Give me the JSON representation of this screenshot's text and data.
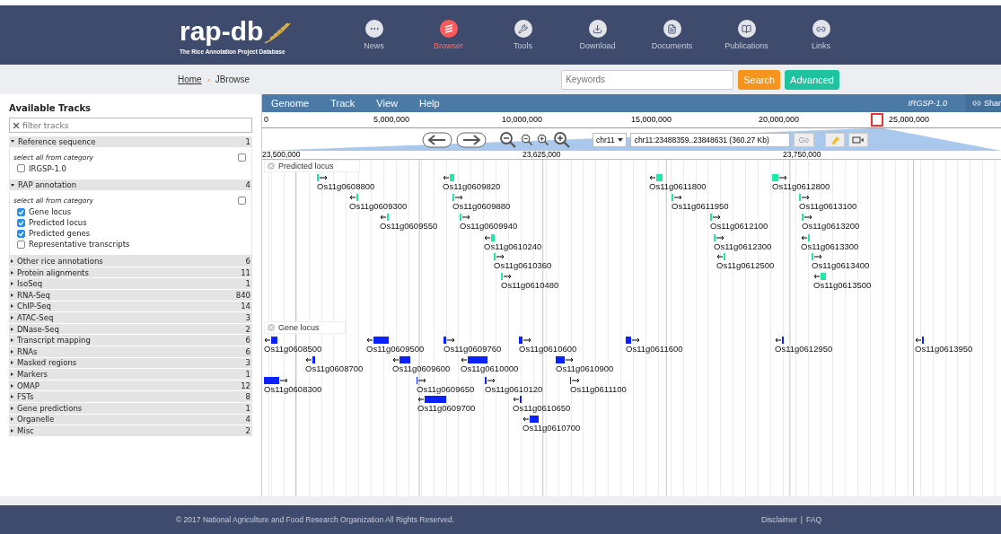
{
  "header": {
    "logo": "rap-db",
    "tagline": "The Rice Annotation Project Database",
    "nav": [
      {
        "label": "News",
        "selected": false,
        "kind": "news"
      },
      {
        "label": "Browser",
        "selected": true,
        "kind": "browser"
      },
      {
        "label": "Tools",
        "selected": false,
        "kind": "tools"
      },
      {
        "label": "Download",
        "selected": false,
        "kind": "download"
      },
      {
        "label": "Documents",
        "selected": false,
        "kind": "documents"
      },
      {
        "label": "Publications",
        "selected": false,
        "kind": "publications"
      },
      {
        "label": "Links",
        "selected": false,
        "kind": "links"
      }
    ]
  },
  "breadcrumb": {
    "items": [
      "Home",
      "JBrowse"
    ],
    "separator": "›"
  },
  "search": {
    "placeholder": "Keywords",
    "search_button": "Search",
    "advanced_button": "Advanced"
  },
  "track_panel": {
    "title": "Available Tracks",
    "filter_placeholder": "filter tracks",
    "categories": [
      {
        "name": "Reference sequence",
        "count": "1",
        "expanded": true,
        "select_all": "select all from category",
        "select_all_checked": false,
        "tracks": [
          {
            "label": "IRGSP-1.0",
            "checked": false
          }
        ]
      },
      {
        "name": "RAP annotation",
        "count": "4",
        "expanded": true,
        "select_all": "select all from category",
        "select_all_checked": false,
        "tracks": [
          {
            "label": "Gene locus",
            "checked": true
          },
          {
            "label": "Predicted locus",
            "checked": true
          },
          {
            "label": "Predicted genes",
            "checked": true
          },
          {
            "label": "Representative transcripts",
            "checked": false
          }
        ]
      },
      {
        "name": "Other rice annotations",
        "count": "6",
        "expanded": false
      },
      {
        "name": "Protein alignments",
        "count": "11",
        "expanded": false
      },
      {
        "name": "IsoSeq",
        "count": "1",
        "expanded": false
      },
      {
        "name": "RNA-Seq",
        "count": "840",
        "expanded": false
      },
      {
        "name": "ChIP-Seq",
        "count": "14",
        "expanded": false
      },
      {
        "name": "ATAC-Seq",
        "count": "3",
        "expanded": false
      },
      {
        "name": "DNase-Seq",
        "count": "2",
        "expanded": false
      },
      {
        "name": "Transcript mapping",
        "count": "6",
        "expanded": false
      },
      {
        "name": "RNAs",
        "count": "6",
        "expanded": false
      },
      {
        "name": "Masked regions",
        "count": "3",
        "expanded": false
      },
      {
        "name": "Markers",
        "count": "1",
        "expanded": false
      },
      {
        "name": "OMAP",
        "count": "12",
        "expanded": false
      },
      {
        "name": "FSTs",
        "count": "8",
        "expanded": false
      },
      {
        "name": "Gene predictions",
        "count": "1",
        "expanded": false
      },
      {
        "name": "Organelle",
        "count": "4",
        "expanded": false
      },
      {
        "name": "Misc",
        "count": "2",
        "expanded": false
      }
    ]
  },
  "browser": {
    "menu": [
      "Genome",
      "Track",
      "View",
      "Help"
    ],
    "assembly": "IRGSP-1.0",
    "share": "Shar",
    "overview_ticks": [
      "0",
      "5,000,000",
      "10,000,000",
      "15,000,000",
      "20,000,000",
      "25,000,000"
    ],
    "chromosome": "chr11",
    "location": "chr11:23488359..23848631 (360.27 Kb)",
    "go_button": "Go",
    "detail_ticks": [
      "23,500,000",
      "23,625,000",
      "23,750,000"
    ],
    "tracks": [
      {
        "label": "Predicted locus",
        "kind": "predicted",
        "features": [
          {
            "name": "Os11g0608800",
            "reverse": false
          },
          {
            "name": "Os11g0609820",
            "reverse": true
          },
          {
            "name": "Os11g0611800",
            "reverse": true
          },
          {
            "name": "Os11g0612800",
            "reverse": false
          },
          {
            "name": "Os11g0609300",
            "reverse": true
          },
          {
            "name": "Os11g0609880",
            "reverse": false
          },
          {
            "name": "Os11g0611950",
            "reverse": false
          },
          {
            "name": "Os11g0613100",
            "reverse": false
          },
          {
            "name": "Os11g0609550",
            "reverse": true
          },
          {
            "name": "Os11g0609940",
            "reverse": false
          },
          {
            "name": "Os11g0612100",
            "reverse": false
          },
          {
            "name": "Os11g0613200",
            "reverse": false
          },
          {
            "name": "Os11g0610240",
            "reverse": true
          },
          {
            "name": "Os11g0612300",
            "reverse": false
          },
          {
            "name": "Os11g0613300",
            "reverse": true
          },
          {
            "name": "Os11g0610360",
            "reverse": false
          },
          {
            "name": "Os11g0612500",
            "reverse": true
          },
          {
            "name": "Os11g0613400",
            "reverse": false
          },
          {
            "name": "Os11g0610480",
            "reverse": false
          },
          {
            "name": "Os11g0613500",
            "reverse": true
          }
        ]
      },
      {
        "label": "Gene locus",
        "kind": "gene",
        "features": [
          {
            "name": "Os11g0608500",
            "reverse": true
          },
          {
            "name": "Os11g0609500",
            "reverse": true
          },
          {
            "name": "Os11g0609760",
            "reverse": false
          },
          {
            "name": "Os11g0610600",
            "reverse": false
          },
          {
            "name": "Os11g0611600",
            "reverse": false
          },
          {
            "name": "Os11g0612950",
            "reverse": true
          },
          {
            "name": "Os11g0613950",
            "reverse": true
          },
          {
            "name": "Os11g0608700",
            "reverse": true
          },
          {
            "name": "Os11g0609600",
            "reverse": true
          },
          {
            "name": "Os11g0610000",
            "reverse": true
          },
          {
            "name": "Os11g0610900",
            "reverse": false
          },
          {
            "name": "Os11g0608300",
            "reverse": false
          },
          {
            "name": "Os11g0609650",
            "reverse": false
          },
          {
            "name": "Os11g0610120",
            "reverse": false
          },
          {
            "name": "Os11g0611100",
            "reverse": false
          },
          {
            "name": "Os11g0609700",
            "reverse": true
          },
          {
            "name": "Os11g0610650",
            "reverse": true
          },
          {
            "name": "Os11g0610700",
            "reverse": true
          }
        ]
      }
    ]
  },
  "footer": {
    "copyright": "© 2017 National Agriculture and Food Research Organization All Rights Reserved.",
    "links": [
      "Disclaimer",
      "FAQ"
    ],
    "separator": "|"
  }
}
